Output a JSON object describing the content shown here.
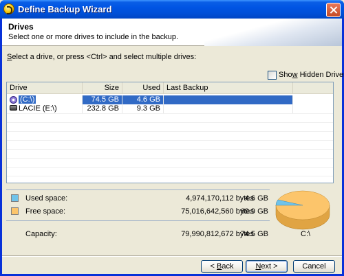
{
  "window": {
    "title": "Define Backup Wizard"
  },
  "header": {
    "title": "Drives",
    "subtitle": "Select one or more drives to include in the backup."
  },
  "instruction": {
    "mnemonic": "S",
    "rest": "elect a drive, or press <Ctrl> and select multiple drives:"
  },
  "show_hidden": {
    "mnemonic": "w",
    "before": "Sho",
    "after": " Hidden Drives",
    "checked": false
  },
  "drive_list": {
    "columns": [
      "Drive",
      "Size",
      "Used",
      "Last Backup"
    ],
    "rows": [
      {
        "drive": "(C:\\)",
        "size": "74.5 GB",
        "used": "4.6 GB",
        "last_backup": "",
        "icon": "cd-drive-icon",
        "selected": true
      },
      {
        "drive": "LACIE (E:\\)",
        "size": "232.8 GB",
        "used": "9.3 GB",
        "last_backup": "",
        "icon": "hard-drive-icon",
        "selected": false
      }
    ]
  },
  "usage": {
    "used": {
      "label": "Used space:",
      "bytes": "4,974,170,112 bytes",
      "size": "4.6 GB",
      "color": "#6fc3ea"
    },
    "free": {
      "label": "Free space:",
      "bytes": "75,016,642,560 bytes",
      "size": "69.9 GB",
      "color": "#fcc56b"
    },
    "capacity": {
      "label": "Capacity:",
      "bytes": "79,990,812,672 bytes",
      "size": "74.5 GB"
    },
    "pie_label": "C:\\",
    "used_fraction": 0.062
  },
  "buttons": {
    "back": {
      "mnemonic": "B",
      "before": "< ",
      "after": "ack"
    },
    "next": {
      "mnemonic": "N",
      "before": "",
      "after": "ext >"
    },
    "cancel": {
      "label": "Cancel"
    }
  }
}
